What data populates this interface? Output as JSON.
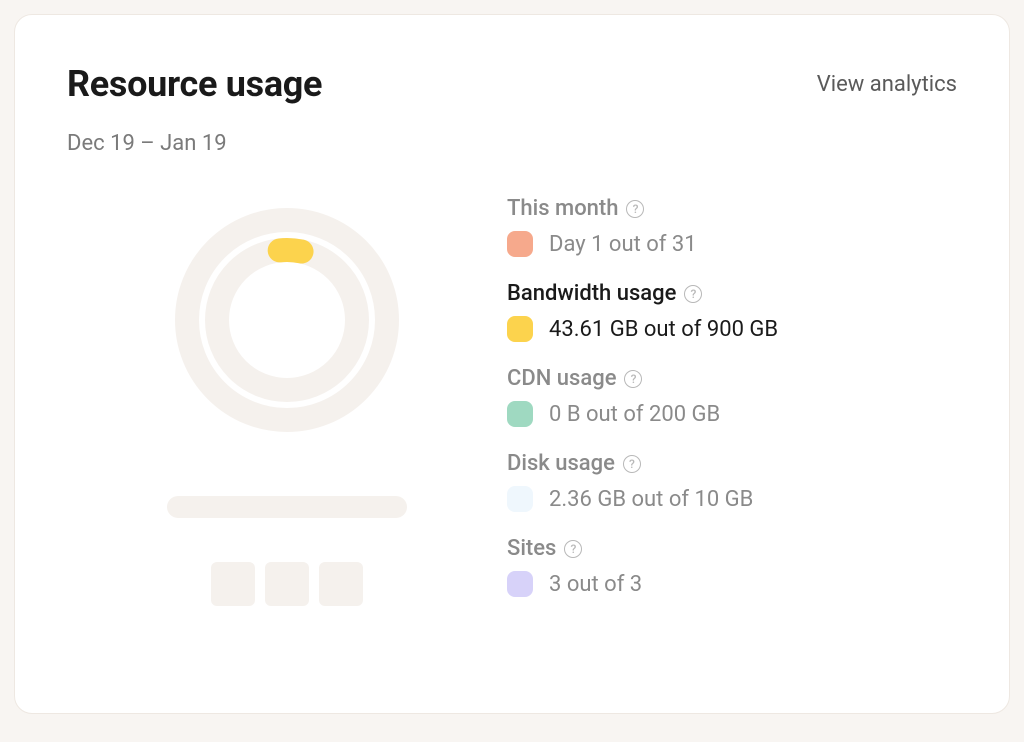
{
  "header": {
    "title": "Resource usage",
    "view_link": "View analytics",
    "date_range": "Dec 19 – Jan 19"
  },
  "colors": {
    "month": "#f6a98c",
    "bandwidth": "#fcd34d",
    "cdn": "#9fd9c1",
    "disk": "#eff7fd",
    "sites": "#d7d2f9",
    "ring_track": "#f5f1ed"
  },
  "chart_data": {
    "type": "pie",
    "title": "Resource usage",
    "series": [
      {
        "name": "This month",
        "value": 1,
        "max": 31,
        "fraction": 0.032
      },
      {
        "name": "Bandwidth usage",
        "value": 43.61,
        "max": 900,
        "fraction": 0.0485
      },
      {
        "name": "CDN usage",
        "value": 0,
        "max": 200,
        "fraction": 0
      },
      {
        "name": "Disk usage",
        "value": 2.36,
        "max": 10,
        "fraction": 0.236
      },
      {
        "name": "Sites",
        "value": 3,
        "max": 3,
        "fraction": 1
      }
    ]
  },
  "metrics": {
    "month": {
      "label": "This month",
      "value": "Day 1 out of 31",
      "active": false
    },
    "bandwidth": {
      "label": "Bandwidth usage",
      "value": "43.61 GB out of 900 GB",
      "active": true
    },
    "cdn": {
      "label": "CDN usage",
      "value": "0 B out of 200 GB",
      "active": false
    },
    "disk": {
      "label": "Disk usage",
      "value": "2.36 GB out of 10 GB",
      "active": false
    },
    "sites": {
      "label": "Sites",
      "value": "3 out of 3",
      "active": false
    }
  }
}
